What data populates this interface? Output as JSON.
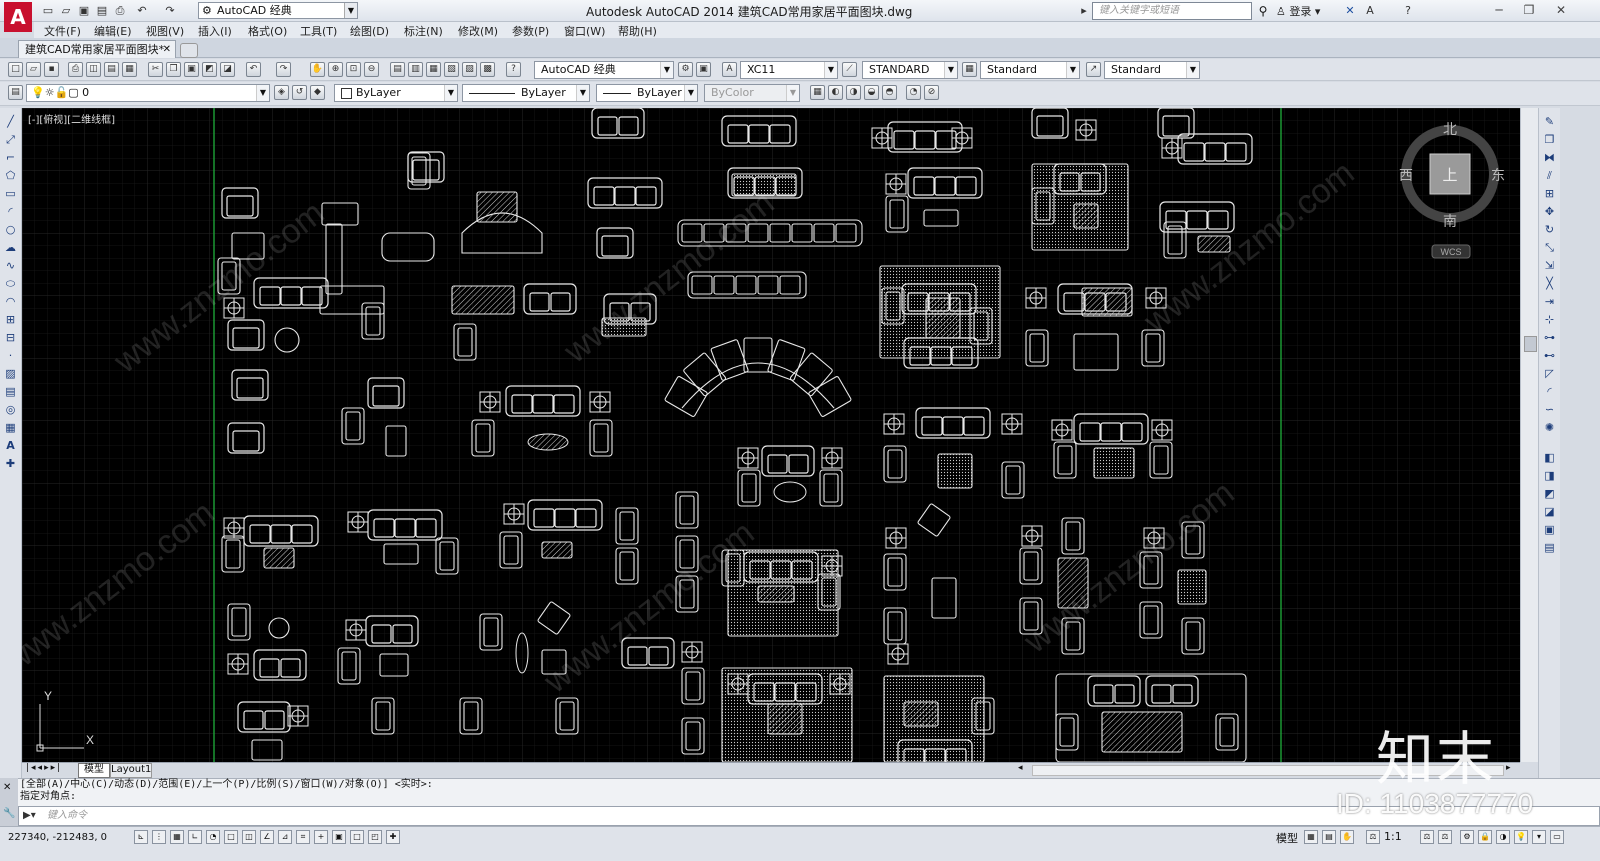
{
  "titlebar": {
    "workspace": "AutoCAD 经典",
    "app_title": "Autodesk AutoCAD 2014    建筑CAD常用家居平面图块.dwg",
    "search_placeholder": "键入关键字或短语",
    "login": "登录"
  },
  "menu": [
    "文件(F)",
    "编辑(E)",
    "视图(V)",
    "插入(I)",
    "格式(O)",
    "工具(T)",
    "绘图(D)",
    "标注(N)",
    "修改(M)",
    "参数(P)",
    "窗口(W)",
    "帮助(H)"
  ],
  "doc_tab": {
    "label": "建筑CAD常用家居平面图块*"
  },
  "toolbar1": {
    "workspace_combo": "AutoCAD 经典",
    "text_style": "XC11",
    "dim_style": "STANDARD",
    "table_style": "Standard",
    "mleader_style": "Standard"
  },
  "toolbar2": {
    "layer": "0",
    "color": "ByLayer",
    "linetype": "ByLayer",
    "lineweight": "ByLayer",
    "plotstyle": "ByColor"
  },
  "canvas": {
    "viewport_label": "[-][俯视][二维线框]",
    "viewcube": {
      "north": "北",
      "south": "南",
      "east": "东",
      "west": "西",
      "face": "上",
      "wcs": "WCS"
    },
    "ucs_x": "X",
    "ucs_y": "Y"
  },
  "layout_tabs": {
    "model": "模型",
    "layout1": "Layout1"
  },
  "command": {
    "history_line1": "[全部(A)/中心(C)/动态(D)/范围(E)/上一个(P)/比例(S)/窗口(W)/对象(O)] <实时>:",
    "history_line2": "指定对角点:",
    "input_placeholder": "键入命令"
  },
  "status": {
    "coords": "227340, -212483, 0",
    "model_label": "模型",
    "scale": "1:1"
  },
  "watermark": {
    "logo": "知末",
    "id": "ID: 1103877770",
    "diag_text": "www.znzmo.com"
  },
  "colors": {
    "canvas_bg": "#000000",
    "border_line": "#1fae3a",
    "grid_minor": "#161616",
    "grid_major": "#232323",
    "drawing_line": "#e8e8e8"
  }
}
